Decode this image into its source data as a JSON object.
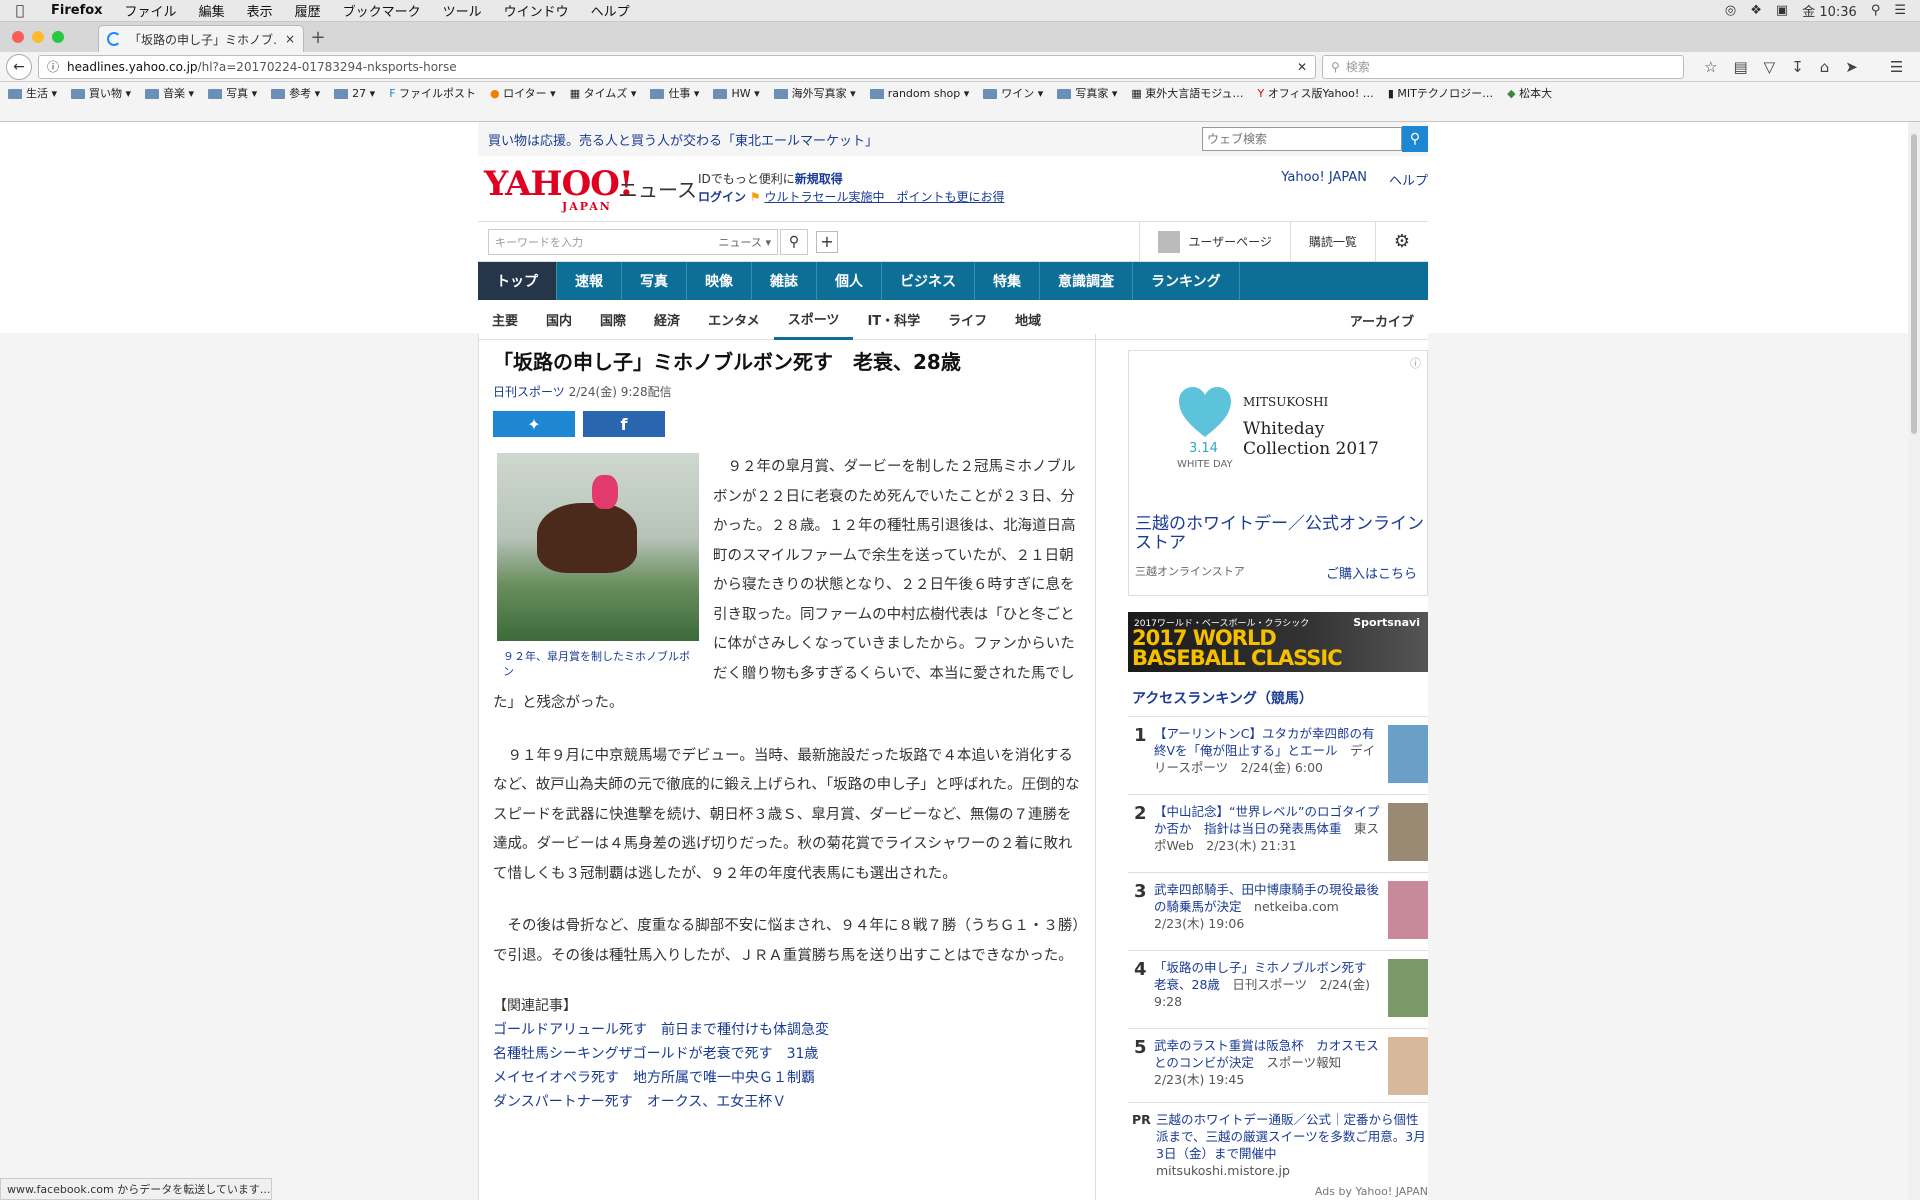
{
  "menubar": {
    "app": "Firefox",
    "items": [
      "ファイル",
      "編集",
      "表示",
      "履歴",
      "ブックマーク",
      "ツール",
      "ウインドウ",
      "ヘルプ"
    ],
    "clock": "金 10:36"
  },
  "tab": {
    "title": "「坂路の申し子」ミホノブ…"
  },
  "navbar": {
    "url_host": "headlines.yahoo.co.jp",
    "url_path": "/hl?a=20170224-01783294-nksports-horse",
    "search_placeholder": "検索"
  },
  "bookmarks": [
    "生活",
    "買い物",
    "音楽",
    "写真",
    "参考",
    "27",
    "ファイルポスト",
    "ロイター",
    "タイムズ",
    "仕事",
    "HW",
    "海外写真家",
    "random shop",
    "ワイン",
    "写真家",
    "東外大言語モジュ…",
    "オフィス版Yahoo! …",
    "MITテクノロジー…",
    "松本大"
  ],
  "colors": {
    "accent": "#0e6f96",
    "link": "#1a3b94",
    "twitter": "#1d87d4",
    "facebook": "#2a66b0",
    "logo": "#e00020"
  },
  "promo": {
    "text": "買い物は応援。売る人と買う人が交わる「東北エールマーケット」",
    "search_placeholder": "ウェブ検索"
  },
  "header": {
    "logo": "YAHOO!",
    "logo_sub": "JAPAN",
    "news": "ニュース",
    "id_line1_a": "IDでもっと便利に",
    "id_line1_b": "新規取得",
    "id_line2_a": "ログイン",
    "id_line2_b": "ウルトラセール実施中　ポイントも更にお得",
    "link_yahoo": "Yahoo! JAPAN",
    "link_help": "ヘルプ"
  },
  "searchrow": {
    "placeholder": "キーワードを入力",
    "scope": "ニュース",
    "user_page": "ユーザーページ",
    "subscriptions": "購読一覧"
  },
  "mainnav": [
    "トップ",
    "速報",
    "写真",
    "映像",
    "雑誌",
    "個人",
    "ビジネス",
    "特集",
    "意識調査",
    "ランキング"
  ],
  "subnav": {
    "items": [
      "主要",
      "国内",
      "国際",
      "経済",
      "エンタメ",
      "スポーツ",
      "IT・科学",
      "ライフ",
      "地域"
    ],
    "archive": "アーカイブ"
  },
  "article": {
    "headline": "「坂路の申し子」ミホノブルボン死す　老衰、28歳",
    "source": "日刊スポーツ",
    "date": "2/24(金) 9:28配信",
    "photo_caption": "９２年、皐月賞を制したミホノブルボン",
    "p1": "　９２年の皐月賞、ダービーを制した２冠馬ミホノブルボンが２２日に老衰のため死んでいたことが２３日、分かった。２８歳。１２年の種牡馬引退後は、北海道日高町のスマイルファームで余生を送っていたが、２１日朝から寝たきりの状態となり、２２日午後６時すぎに息を引き取った。同ファームの中村広樹代表は「ひと冬ごとに体がさみしくなっていきましたから。ファンからいただく贈り物も多すぎるくらいで、本当に愛された馬でした」と残念がった。",
    "p2": "　９１年９月に中京競馬場でデビュー。当時、最新施設だった坂路で４本追いを消化するなど、故戸山為夫師の元で徹底的に鍛え上げられ、「坂路の申し子」と呼ばれた。圧倒的なスピードを武器に快進撃を続け、朝日杯３歳Ｓ、皐月賞、ダービーなど、無傷の７連勝を達成。ダービーは４馬身差の逃げ切りだった。秋の菊花賞でライスシャワーの２着に敗れて惜しくも３冠制覇は逃したが、９２年の年度代表馬にも選出された。",
    "p3": "　その後は骨折など、度重なる脚部不安に悩まされ、９４年に８戦７勝（うちＧ１・３勝）で引退。その後は種牡馬入りしたが、ＪＲＡ重賞勝ち馬を送り出すことはできなかった。",
    "related_heading": "【関連記事】",
    "related": [
      "ゴールドアリュール死す　前日まで種付けも体調急変",
      "名種牡馬シーキングザゴールドが老衰で死す　31歳",
      "メイセイオペラ死す　地方所属で唯一中央Ｇ１制覇",
      "ダンスパートナー死す　オークス、エ女王杯Ｖ"
    ]
  },
  "ad": {
    "date": "3.14",
    "whiteday": "WHITE DAY",
    "brand": "MITSUKOSHI",
    "line1": "Whiteday",
    "line2": "Collection 2017",
    "title": "三越のホワイトデー／公式オンラインストア",
    "store": "三越オンラインストア",
    "buy": "ご購入はこちら"
  },
  "wbc": {
    "small": "2017ワールド・ベースボール・クラシック",
    "line1": "2017 WORLD",
    "line2": "BASEBALL CLASSIC",
    "logo": "Sportsnavi"
  },
  "ranking": {
    "heading": "アクセスランキング（競馬）",
    "items": [
      {
        "n": "1",
        "title": "【アーリントンC】ユタカが幸四郎の有終Vを「俺が阻止する」とエール",
        "meta": "デイリースポーツ　2/24(金) 6:00"
      },
      {
        "n": "2",
        "title": "【中山記念】“世界レベル”のロゴタイプか否か　指針は当日の発表馬体重",
        "meta": "東スポWeb　2/23(木) 21:31"
      },
      {
        "n": "3",
        "title": "武幸四郎騎手、田中博康騎手の現役最後の騎乗馬が決定",
        "meta": "netkeiba.com　2/23(木) 19:06"
      },
      {
        "n": "4",
        "title": "「坂路の申し子」ミホノブルボン死す　老衰、28歳",
        "meta": "日刊スポーツ　2/24(金) 9:28"
      },
      {
        "n": "5",
        "title": "武幸のラスト重賞は阪急杯　カオスモスとのコンビが決定",
        "meta": "スポーツ報知　2/23(木) 19:45"
      }
    ]
  },
  "pr": {
    "label": "PR",
    "text": "三越のホワイトデー通販／公式｜定番から個性派まで、三越の厳選スイーツを多数ご用意。3月3日（金）まで開催中",
    "domain": "mitsukoshi.mistore.jp",
    "adsby": "Ads by Yahoo! JAPAN"
  },
  "status": "www.facebook.com からデータを転送しています..."
}
